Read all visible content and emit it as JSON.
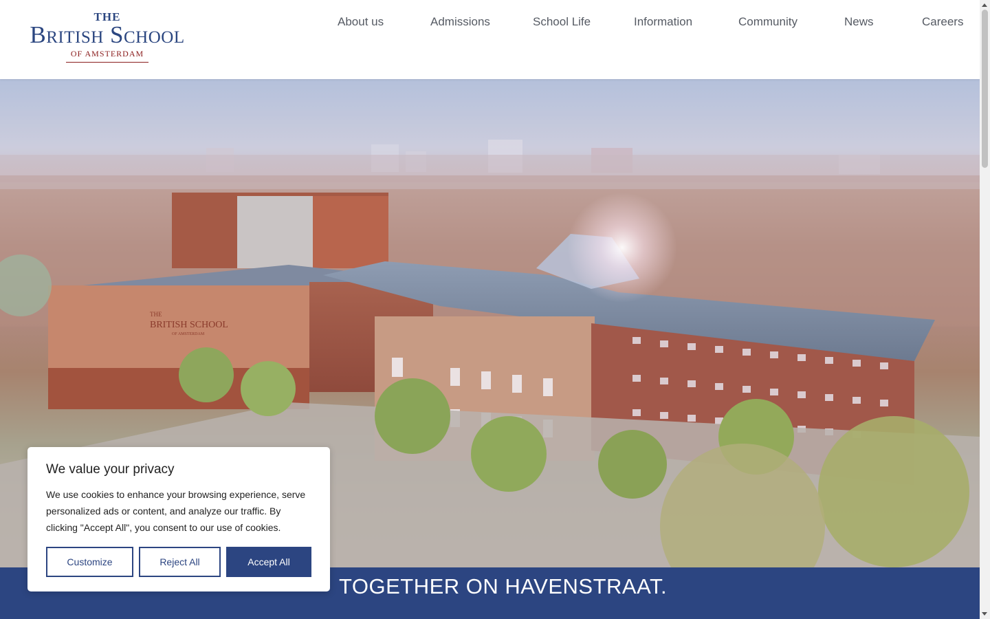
{
  "logo": {
    "the": "THE",
    "name": "British School",
    "sub": "OF AMSTERDAM"
  },
  "nav": {
    "items": [
      "About us",
      "Admissions",
      "School Life",
      "Information",
      "Community",
      "News",
      "Careers"
    ]
  },
  "hero": {
    "building_sign_line1": "THE",
    "building_sign_line2": "BRITISH SCHOOL",
    "building_sign_line3": "OF AMSTERDAM",
    "banner_text": "TOGETHER ON HAVENSTRAAT."
  },
  "cookie": {
    "title": "We value your privacy",
    "text": "We use cookies to enhance your browsing experience, serve personalized ads or content, and analyze our traffic. By clicking \"Accept All\", you consent to our use of cookies.",
    "customize_label": "Customize",
    "reject_label": "Reject All",
    "accept_label": "Accept All"
  },
  "colors": {
    "brand_blue": "#2c4581",
    "brand_red": "#8a1c1c"
  }
}
